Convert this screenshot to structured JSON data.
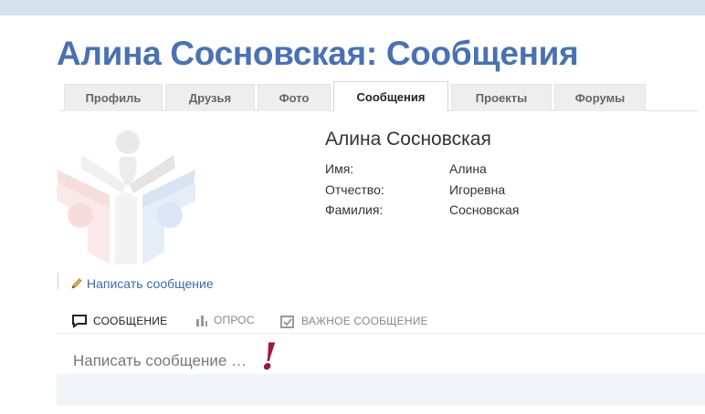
{
  "page": {
    "title": "Алина Сосновская: Сообщения"
  },
  "tabs": [
    {
      "label": "Профиль",
      "active": false
    },
    {
      "label": "Друзья",
      "active": false
    },
    {
      "label": "Фото",
      "active": false
    },
    {
      "label": "Сообщения",
      "active": true
    },
    {
      "label": "Проекты",
      "active": false
    },
    {
      "label": "Форумы",
      "active": false
    }
  ],
  "profile": {
    "name": "Алина Сосновская",
    "fields": [
      {
        "label": "Имя:",
        "value": "Алина"
      },
      {
        "label": "Отчество:",
        "value": "Игоревна"
      },
      {
        "label": "Фамилия:",
        "value": "Сосновская"
      }
    ]
  },
  "actions": {
    "write_message": "Написать сообщение"
  },
  "post_types": [
    {
      "label": "СООБЩЕНИЕ",
      "icon": "speech-bubble-icon",
      "active": true
    },
    {
      "label": "ОПРОС",
      "icon": "bar-chart-icon",
      "active": false
    },
    {
      "label": "ВАЖНОЕ СООБЩЕНИЕ",
      "icon": "checkbox-icon",
      "active": false
    }
  ],
  "composer": {
    "placeholder": "Написать сообщение …",
    "marker": "!"
  },
  "colors": {
    "accent": "#4a72b0",
    "link": "#3c6aa8",
    "marker": "#9a1b3c",
    "topbar": "#d5e1ef"
  }
}
